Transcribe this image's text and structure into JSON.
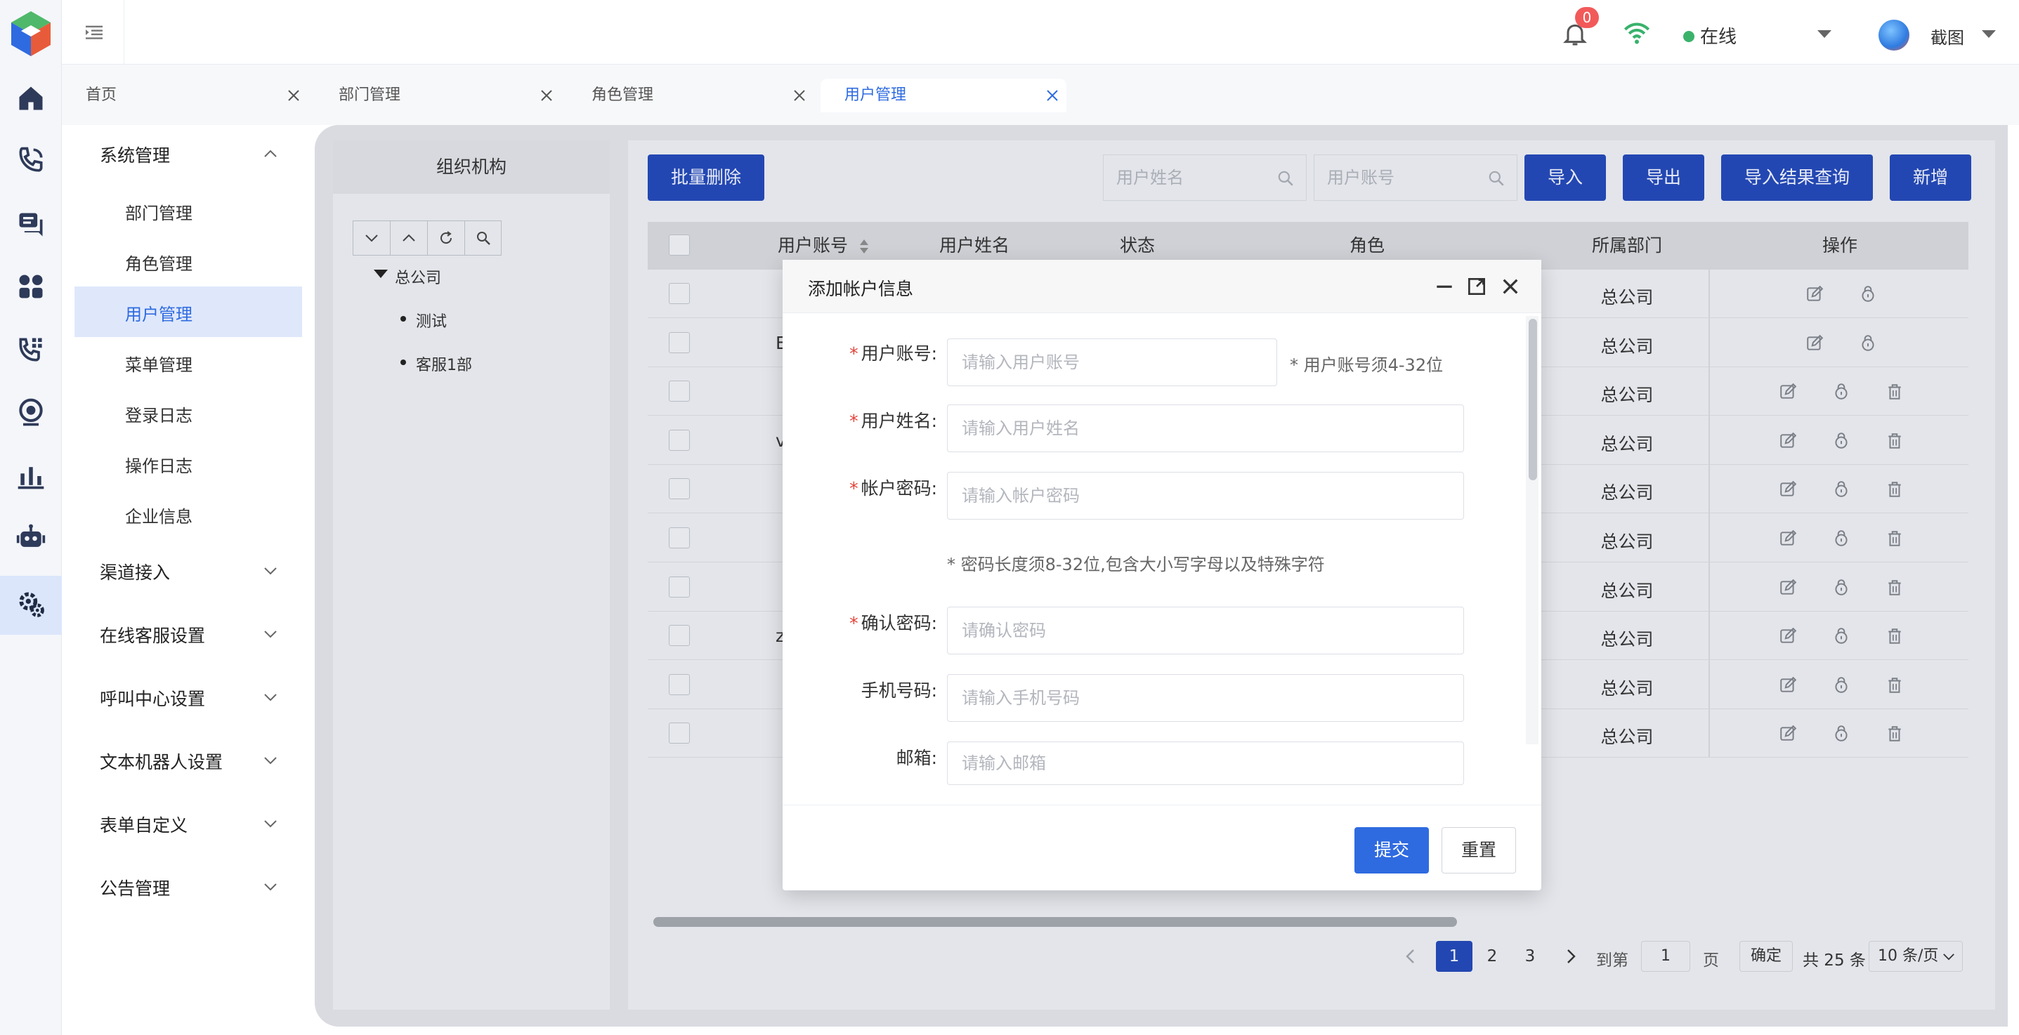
{
  "header": {
    "notification_count": "0",
    "status_text": "在线",
    "user_name": "截图"
  },
  "tabs": [
    {
      "label": "首页"
    },
    {
      "label": "部门管理"
    },
    {
      "label": "角色管理"
    },
    {
      "label": "用户管理",
      "active": true
    }
  ],
  "rail_icons": [
    "home-icon",
    "phone-call-icon",
    "chat-icon",
    "apps-icon",
    "phone-grid-icon",
    "location-icon",
    "bar-chart-icon",
    "robot-icon",
    "settings-gears-icon"
  ],
  "sidebar": {
    "group_system": "系统管理",
    "sub_items": [
      "部门管理",
      "角色管理",
      "用户管理",
      "菜单管理",
      "登录日志",
      "操作日志",
      "企业信息"
    ],
    "groups": [
      "渠道接入",
      "在线客服设置",
      "呼叫中心设置",
      "文本机器人设置",
      "表单自定义",
      "公告管理"
    ]
  },
  "org": {
    "title": "组织机构",
    "root": "总公司",
    "children": [
      "测试",
      "客服1部"
    ]
  },
  "toolbar": {
    "batch_delete": "批量删除",
    "search_name_placeholder": "用户姓名",
    "search_account_placeholder": "用户账号",
    "import": "导入",
    "export": "导出",
    "import_result": "导入结果查询",
    "add": "新增"
  },
  "table": {
    "columns": [
      "用户账号",
      "用户姓名",
      "状态",
      "角色",
      "所属部门",
      "操作"
    ],
    "rows": [
      {
        "account": "",
        "dept": "总公司",
        "deletable": false
      },
      {
        "account": "E",
        "dept": "总公司",
        "deletable": false
      },
      {
        "account": "",
        "dept": "总公司",
        "deletable": true
      },
      {
        "account": "v",
        "dept": "总公司",
        "deletable": true
      },
      {
        "account": "",
        "dept": "总公司",
        "deletable": true
      },
      {
        "account": "",
        "dept": "总公司",
        "deletable": true
      },
      {
        "account": "",
        "dept": "总公司",
        "deletable": true
      },
      {
        "account": "z",
        "dept": "总公司",
        "deletable": true
      },
      {
        "account": "",
        "dept": "总公司",
        "deletable": true
      },
      {
        "account": "",
        "dept": "总公司",
        "deletable": true
      }
    ]
  },
  "pagination": {
    "pages": [
      "1",
      "2",
      "3"
    ],
    "goto_label": "到第",
    "goto_value": "1",
    "page_unit": "页",
    "confirm": "确定",
    "total": "共 25 条",
    "page_size": "10 条/页"
  },
  "modal": {
    "title": "添加帐户信息",
    "fields": {
      "account_label": "用户账号:",
      "account_placeholder": "请输入用户账号",
      "account_hint": "* 用户账号须4-32位",
      "name_label": "用户姓名:",
      "name_placeholder": "请输入用户姓名",
      "password_label": "帐户密码:",
      "password_placeholder": "请输入帐户密码",
      "password_hint": "* 密码长度须8-32位,包含大小写字母以及特殊字符",
      "confirm_label": "确认密码:",
      "confirm_placeholder": "请确认密码",
      "phone_label": "手机号码:",
      "phone_placeholder": "请输入手机号码",
      "email_label": "邮箱:",
      "email_placeholder": "请输入邮箱"
    },
    "submit": "提交",
    "reset": "重置"
  }
}
